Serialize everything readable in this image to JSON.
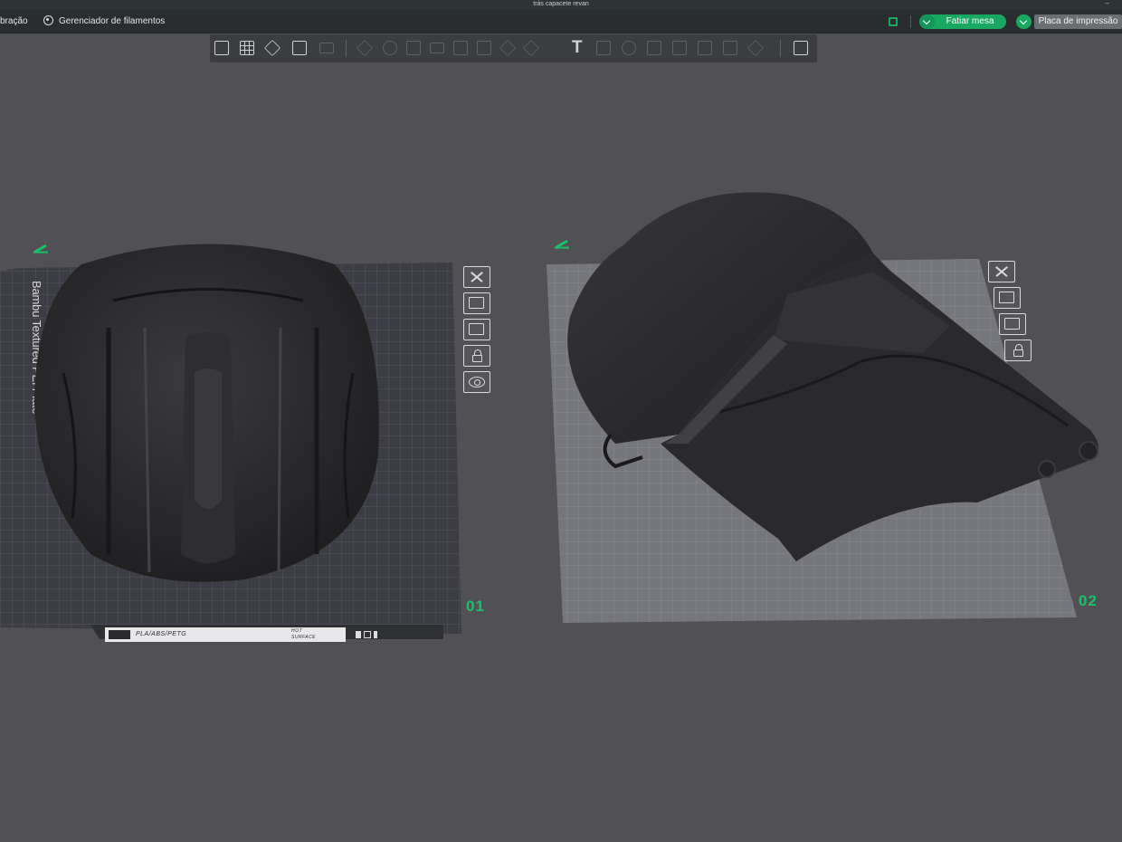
{
  "window": {
    "title": "trás capacete revan"
  },
  "menu": {
    "calibration_partial": "bração",
    "filament_manager": "Gerenciador de filamentos"
  },
  "actions": {
    "slice_label": "Fatiar mesa",
    "print_label": "Placa de impressão"
  },
  "plates": [
    {
      "number": "01",
      "bed_name": "Bambu Textured PEI Plate",
      "footer_materials": "PLA/ABS/PETG",
      "footer_warning": "HOT SURFACE"
    },
    {
      "number": "02"
    }
  ],
  "colors": {
    "accent": "#19c26a",
    "background": "#505055",
    "model": "#2b2b2d"
  },
  "icons": [
    "add-cube-icon",
    "arrange-grid-icon",
    "orient-icon",
    "layout-icon",
    "split-icon",
    "move-icon",
    "rotate-icon",
    "scale-icon",
    "lay-on-face-icon",
    "cut-icon",
    "support-paint-icon",
    "seam-paint-icon",
    "color-paint-icon",
    "text-icon",
    "boolean-icon",
    "measure-icon",
    "assembly-icon",
    "variable-layer-icon",
    "export-icon"
  ]
}
